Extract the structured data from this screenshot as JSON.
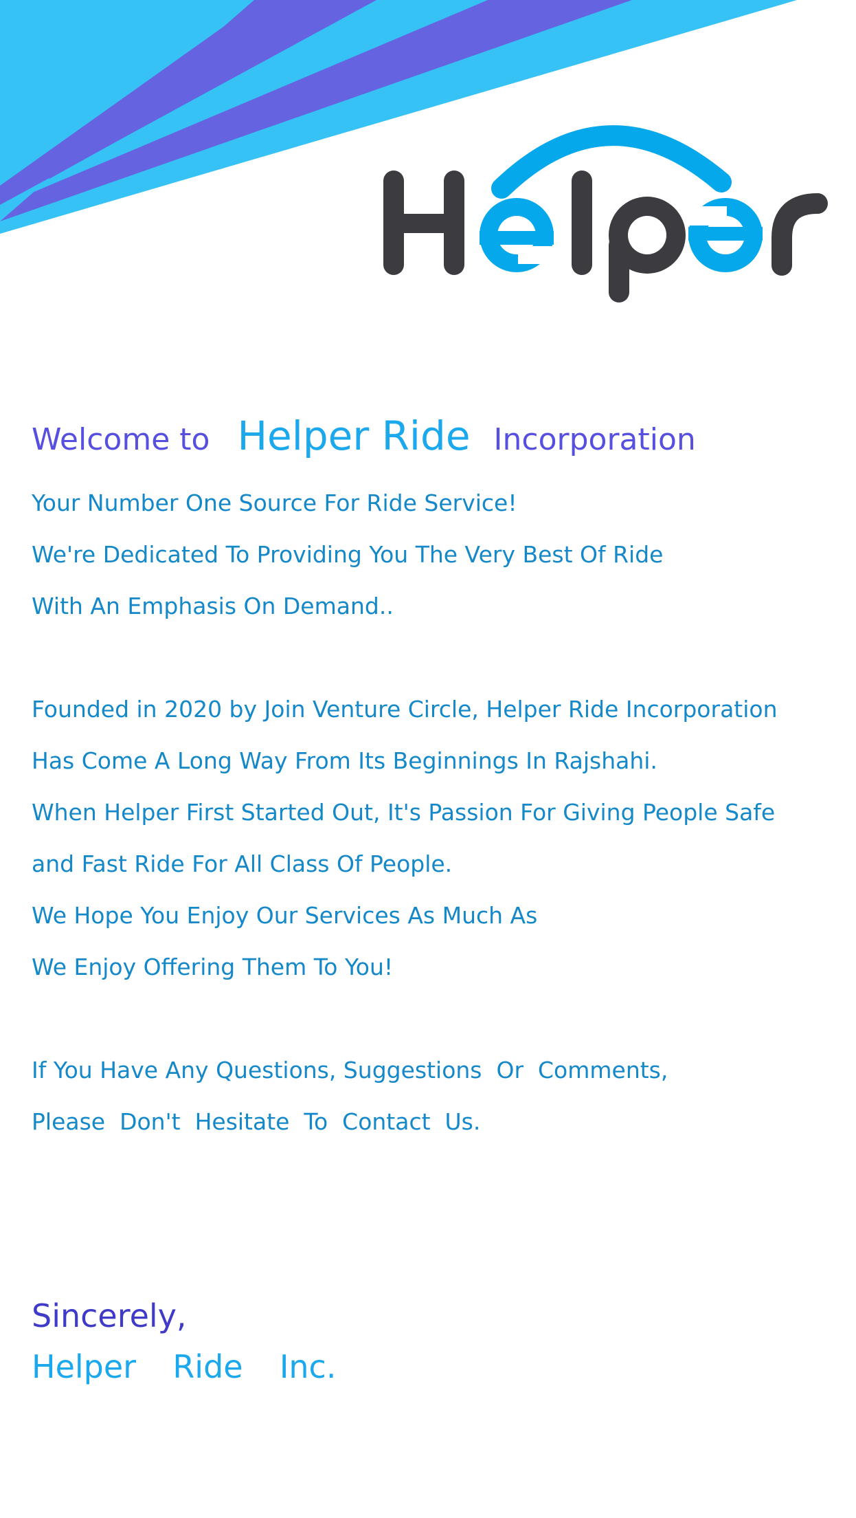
{
  "logo": {
    "text": "Helper",
    "colors": {
      "dark": "#3c3c40",
      "accent": "#06a8ec"
    }
  },
  "banner": {
    "colors": {
      "light": "#36c2f5",
      "violet": "#6663e0"
    }
  },
  "welcome": {
    "prefix": "Welcome to",
    "brand": "Helper Ride",
    "suffix": "Incorporation"
  },
  "paragraph1": [
    "Your Number One Source For Ride Service!",
    "We're Dedicated To Providing You The Very Best Of Ride",
    "With An Emphasis On Demand.."
  ],
  "paragraph2": [
    "Founded in 2020 by Join Venture Circle, Helper Ride Incorporation",
    "Has Come A Long Way From Its Beginnings In Rajshahi.",
    "When Helper First Started Out, It's Passion For Giving People Safe",
    "and Fast Ride  For All Class Of People.",
    "We Hope You Enjoy Our Services As Much As",
    "We Enjoy Offering Them To You!"
  ],
  "paragraph3": [
    "If You Have Any Questions, Suggestions  Or  Comments,",
    "Please  Don't  Hesitate  To  Contact  Us."
  ],
  "closing": {
    "salutation": "Sincerely,",
    "signature": "Helper  Ride  Inc."
  }
}
